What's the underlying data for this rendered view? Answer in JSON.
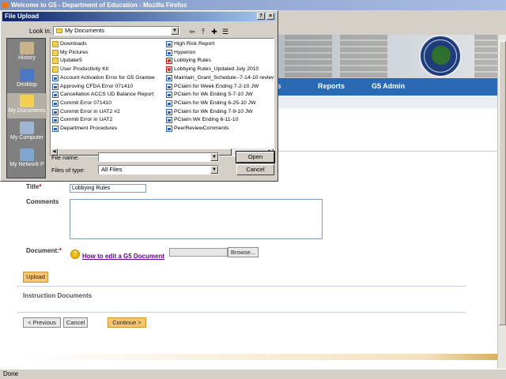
{
  "window": {
    "title": "Welcome to G5 - Department of Education - Mozilla Firefox"
  },
  "status": {
    "text": "Done"
  },
  "nav": {
    "items": [
      "nts",
      "Reports",
      "G5 Admin"
    ]
  },
  "form": {
    "title_label": "Title",
    "title_value": "Lobbying Rules",
    "comments_label": "Comments",
    "document_label": "Document:",
    "help_link": "How to edit a G5 Document",
    "browse_label": "Browse...",
    "upload_label": "Upload",
    "instruction_title": "Instruction Documents",
    "previous_label": "< Previous",
    "cancel_label": "Cancel",
    "continue_label": "Continue >"
  },
  "dialog": {
    "title": "File Upload",
    "look_in_label": "Look in:",
    "look_in_value": "My Documents",
    "places": [
      "History",
      "Desktop",
      "My Documents",
      "My Computer",
      "My Network P"
    ],
    "files_col1": [
      {
        "name": "Downloads",
        "type": "folder"
      },
      {
        "name": "My Pictures",
        "type": "folder"
      },
      {
        "name": "Updater5",
        "type": "folder"
      },
      {
        "name": "User Productivity Kit",
        "type": "folder"
      },
      {
        "name": "Account Activation Error for G5 Grantee",
        "type": "doc"
      },
      {
        "name": "Approving CFDA Error 071410",
        "type": "doc"
      },
      {
        "name": "Cancellation ACCS UD Balance Report",
        "type": "doc"
      },
      {
        "name": "Commit Error 071410",
        "type": "doc"
      },
      {
        "name": "Commit Error in UAT2 #2",
        "type": "doc"
      },
      {
        "name": "Commit Error in UAT2",
        "type": "doc"
      },
      {
        "name": "Department Procedures",
        "type": "doc"
      }
    ],
    "files_col2": [
      {
        "name": "High Risk Report",
        "type": "doc"
      },
      {
        "name": "Hyperion",
        "type": "doc"
      },
      {
        "name": "Lobbying Rules",
        "type": "pdf"
      },
      {
        "name": "Lobbying Rules_Updated July 2010",
        "type": "pdf"
      },
      {
        "name": "Maintain_Grant_Schedule--7-14-10 review",
        "type": "doc"
      },
      {
        "name": "PClaim for Week Ending 7-2-10 JW",
        "type": "doc"
      },
      {
        "name": "PClaim for Wk Ending 5-7-10 JW",
        "type": "doc"
      },
      {
        "name": "PClaim for Wk Ending 6-25-10 JW",
        "type": "doc"
      },
      {
        "name": "PClaim for Wk Ending 7-9-10 JW",
        "type": "doc"
      },
      {
        "name": "PClaim Wk Ending 6-11-10",
        "type": "doc"
      },
      {
        "name": "PeerReviewComments",
        "type": "doc"
      }
    ],
    "file_name_label": "File name:",
    "file_name_value": "",
    "files_of_type_label": "Files of type:",
    "files_of_type_value": "All Files",
    "open_label": "Open",
    "cancel_label": "Cancel",
    "help_btn": "?",
    "close_btn": "×"
  }
}
